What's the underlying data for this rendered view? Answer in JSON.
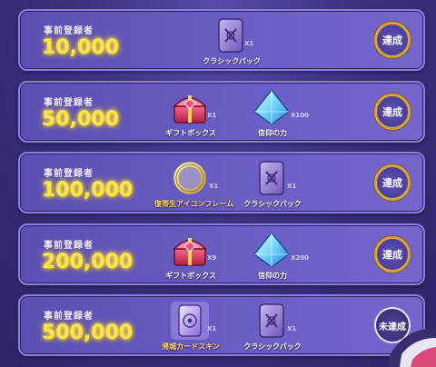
{
  "tiers": [
    {
      "label": "事前登録者",
      "count": "10,000",
      "rewards": [
        {
          "name": "クラシックパック",
          "multiplier": "X1",
          "icon": "classic-pack-icon"
        }
      ],
      "status": "達成"
    },
    {
      "label": "事前登録者",
      "count": "50,000",
      "rewards": [
        {
          "name": "ギフトボックス",
          "multiplier": "X1",
          "icon": "gift-box-icon"
        },
        {
          "name": "信仰の力",
          "multiplier": "X100",
          "icon": "faith-crystal-icon"
        }
      ],
      "status": "達成"
    },
    {
      "label": "事前登録者",
      "count": "100,000",
      "rewards": [
        {
          "name": "復帯生アイコンフレーム",
          "multiplier": "X1",
          "icon": "icon-frame-icon"
        },
        {
          "name": "クラシックパック",
          "multiplier": "X1",
          "icon": "classic-pack-icon"
        }
      ],
      "status": "達成"
    },
    {
      "label": "事前登録者",
      "count": "200,000",
      "rewards": [
        {
          "name": "ギフトボックス",
          "multiplier": "X9",
          "icon": "gift-box-icon"
        },
        {
          "name": "信仰の力",
          "multiplier": "X200",
          "icon": "faith-crystal-icon"
        }
      ],
      "status": "達成"
    },
    {
      "label": "事前登録者",
      "count": "500,000",
      "rewards": [
        {
          "name": "帰城カードスキン",
          "multiplier": "X1",
          "icon": "card-skin-icon"
        },
        {
          "name": "クラシックパック",
          "multiplier": "X1",
          "icon": "classic-pack-icon"
        }
      ],
      "status": "未達成"
    }
  ],
  "colors": {
    "count": "#ffe34a",
    "achieved_ring": "#d9a53a",
    "panel": "#6a5ec4"
  }
}
